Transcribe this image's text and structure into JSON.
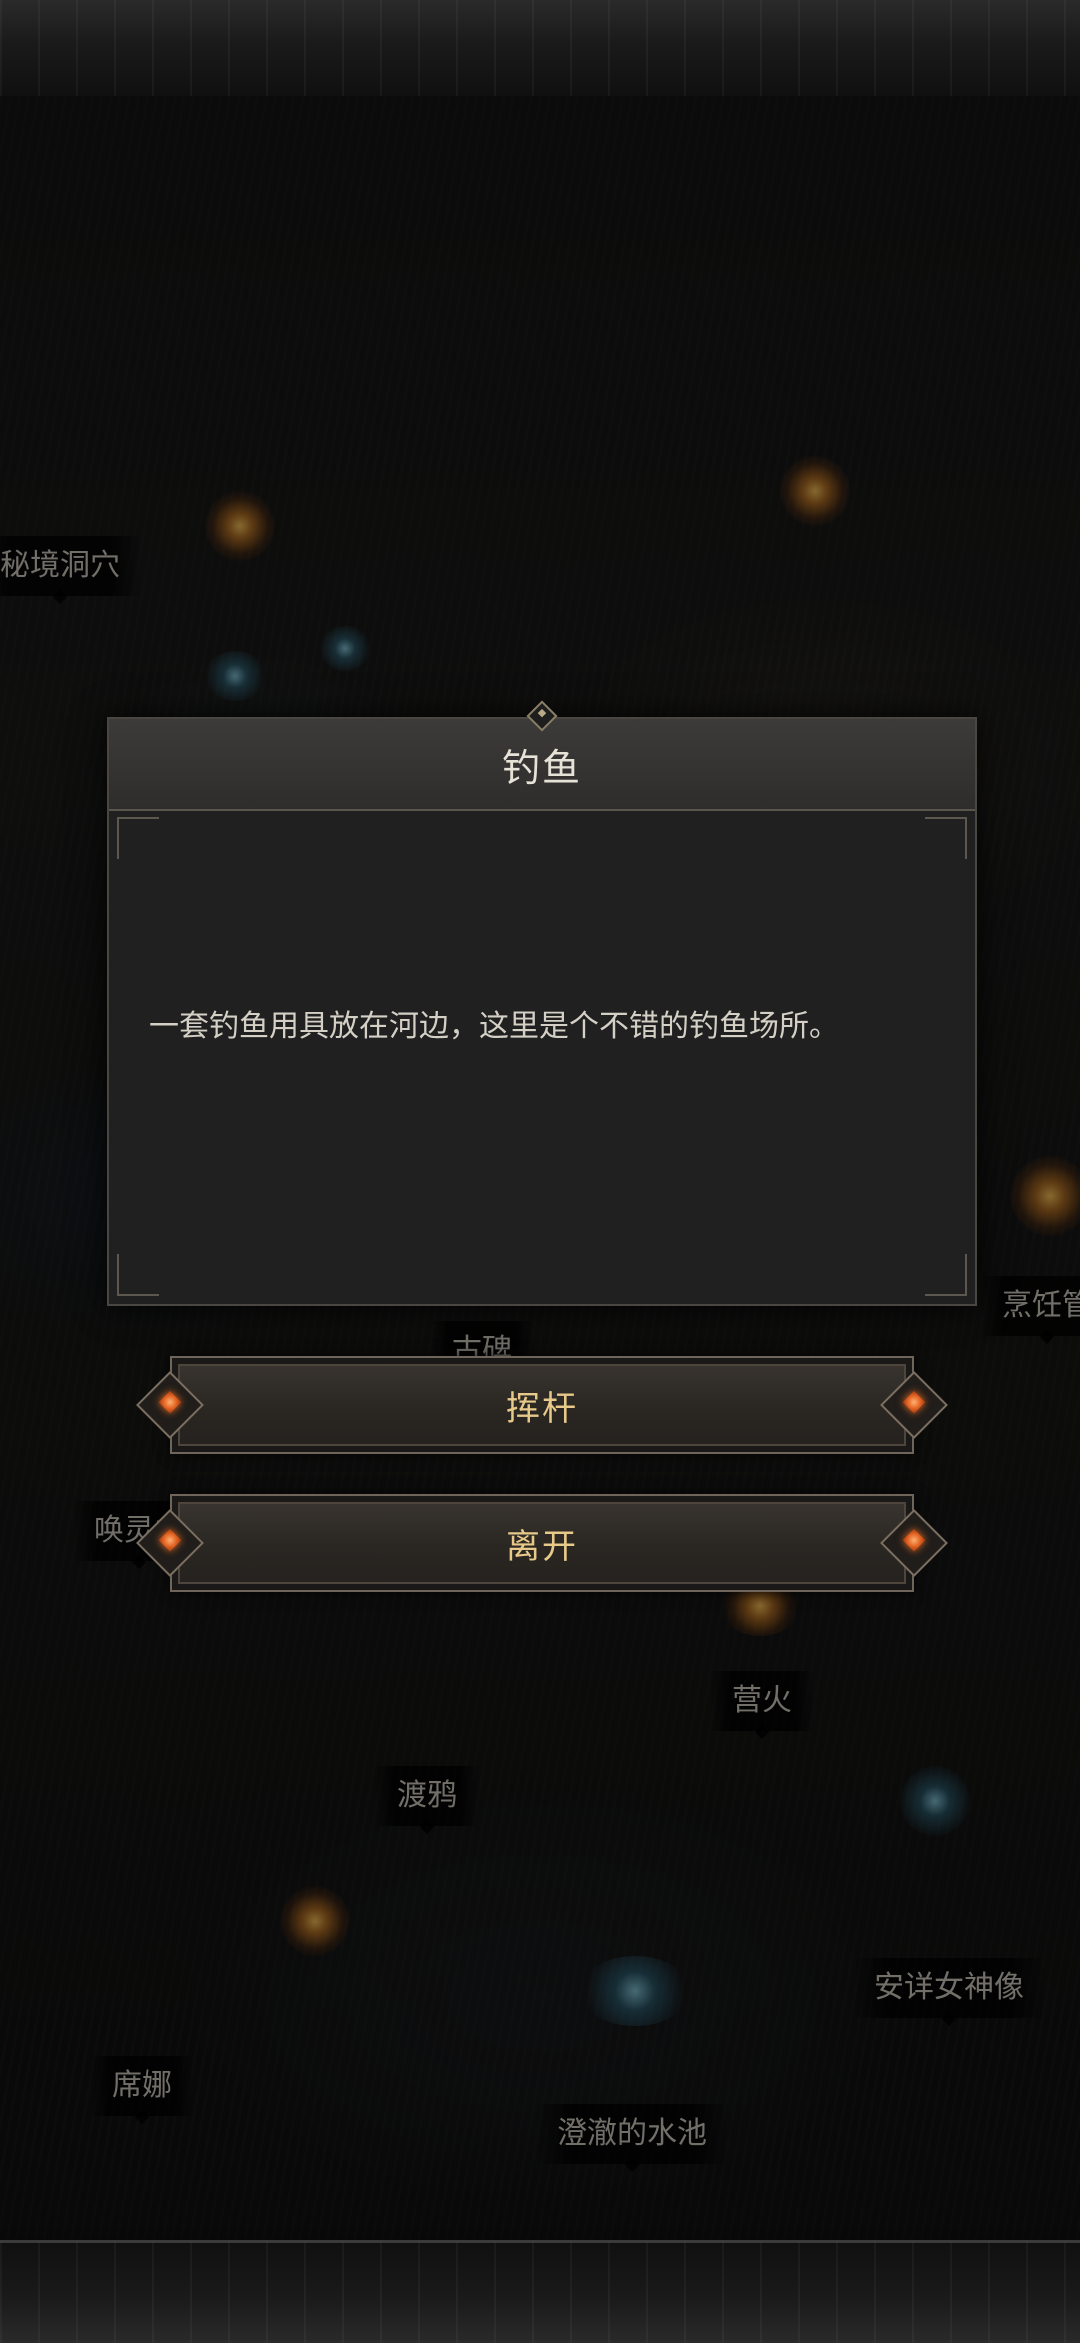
{
  "map": {
    "labels": {
      "secret_cave": "秘境洞穴",
      "cooking": "烹饪管",
      "monument": "古碑",
      "summon": "唤灵之",
      "campfire": "营火",
      "raven": "渡鸦",
      "goddess": "安详女神像",
      "xina": "席娜",
      "pool": "澄澈的水池"
    }
  },
  "dialog": {
    "title": "钓鱼",
    "body": "一套钓鱼用具放在河边，这里是个不错的钓鱼场所。"
  },
  "actions": {
    "swing_rod": "挥杆",
    "leave": "离开"
  }
}
